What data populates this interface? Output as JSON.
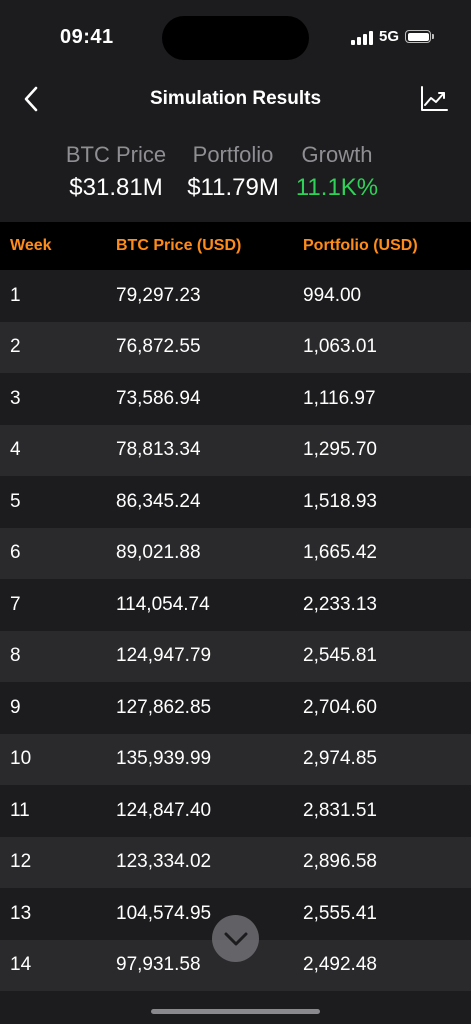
{
  "status_bar": {
    "time": "09:41",
    "network": "5G"
  },
  "nav": {
    "title": "Simulation Results",
    "back_icon": "chevron-left-icon",
    "chart_icon": "trending-up-chart-icon"
  },
  "summary": {
    "btc_label": "BTC Price",
    "btc_value": "$31.81M",
    "portfolio_label": "Portfolio",
    "portfolio_value": "$11.79M",
    "growth_label": "Growth",
    "growth_value": "11.1K%"
  },
  "table": {
    "headers": [
      "Week",
      "BTC Price (USD)",
      "Portfolio (USD)"
    ],
    "rows": [
      {
        "week": "1",
        "price": "79,297.23",
        "portfolio": "994.00"
      },
      {
        "week": "2",
        "price": "76,872.55",
        "portfolio": "1,063.01"
      },
      {
        "week": "3",
        "price": "73,586.94",
        "portfolio": "1,116.97"
      },
      {
        "week": "4",
        "price": "78,813.34",
        "portfolio": "1,295.70"
      },
      {
        "week": "5",
        "price": "86,345.24",
        "portfolio": "1,518.93"
      },
      {
        "week": "6",
        "price": "89,021.88",
        "portfolio": "1,665.42"
      },
      {
        "week": "7",
        "price": "114,054.74",
        "portfolio": "2,233.13"
      },
      {
        "week": "8",
        "price": "124,947.79",
        "portfolio": "2,545.81"
      },
      {
        "week": "9",
        "price": "127,862.85",
        "portfolio": "2,704.60"
      },
      {
        "week": "10",
        "price": "135,939.99",
        "portfolio": "2,974.85"
      },
      {
        "week": "11",
        "price": "124,847.40",
        "portfolio": "2,831.51"
      },
      {
        "week": "12",
        "price": "123,334.02",
        "portfolio": "2,896.58"
      },
      {
        "week": "13",
        "price": "104,574.95",
        "portfolio": "2,555.41"
      },
      {
        "week": "14",
        "price": "97,931.58",
        "portfolio": "2,492.48"
      }
    ]
  },
  "colors": {
    "accent_orange": "#ff8c1a",
    "growth_green": "#30d158",
    "background": "#1c1c1e"
  },
  "scroll_button_icon": "chevron-down-icon"
}
